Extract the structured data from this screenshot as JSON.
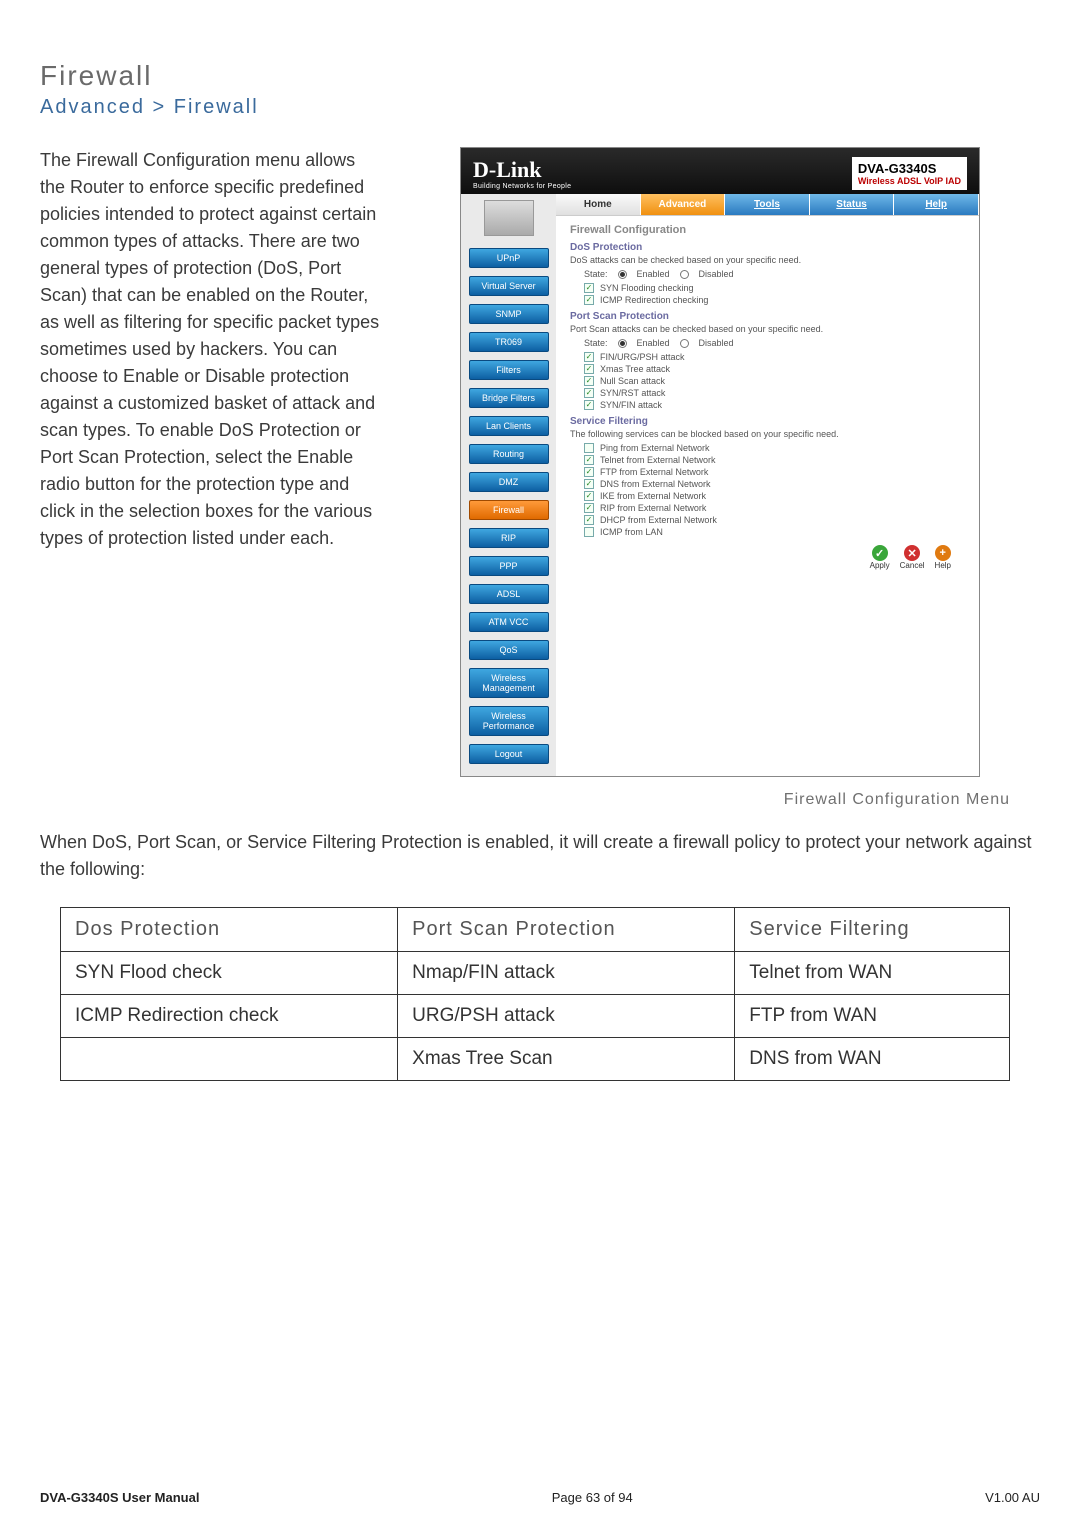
{
  "page": {
    "title": "Firewall",
    "breadcrumb": "Advanced > Firewall",
    "intro": "The Firewall Configuration menu allows the Router to enforce specific predefined policies intended to protect against certain common types of attacks. There are two general types of protection (DoS, Port Scan) that can be enabled on the Router, as well as filtering for specific packet types sometimes used by hackers. You can choose to Enable or Disable protection against a customized basket of attack and scan types. To enable DoS Protection or Port Scan Protection, select the Enable radio button for the protection type and click in the selection boxes for the various types of protection listed under each."
  },
  "screenshot": {
    "brand": "D-Link",
    "brand_sub": "Building Networks for People",
    "model": "DVA-G3340S",
    "model_sub": "Wireless ADSL VoIP IAD",
    "tabs": [
      "Home",
      "Advanced",
      "Tools",
      "Status",
      "Help"
    ],
    "tab_active": 1,
    "sidebar": [
      "UPnP",
      "Virtual Server",
      "SNMP",
      "TR069",
      "Filters",
      "Bridge Filters",
      "Lan Clients",
      "Routing",
      "DMZ",
      "Firewall",
      "RIP",
      "PPP",
      "ADSL",
      "ATM VCC",
      "QoS",
      "Wireless Management",
      "Wireless Performance",
      "Logout"
    ],
    "sidebar_active": 9,
    "fc_title": "Firewall Configuration",
    "dos": {
      "title": "DoS Protection",
      "desc": "DoS attacks can be checked based on your specific need.",
      "state_label": "State:",
      "enabled": "Enabled",
      "disabled": "Disabled",
      "checks": [
        "SYN Flooding checking",
        "ICMP Redirection checking"
      ]
    },
    "portscan": {
      "title": "Port Scan Protection",
      "desc": "Port Scan attacks can be checked based on your specific need.",
      "state_label": "State:",
      "enabled": "Enabled",
      "disabled": "Disabled",
      "checks": [
        "FIN/URG/PSH attack",
        "Xmas Tree attack",
        "Null Scan attack",
        "SYN/RST attack",
        "SYN/FIN attack"
      ]
    },
    "service": {
      "title": "Service Filtering",
      "desc": "The following services can be blocked based on your specific need.",
      "items": [
        {
          "label": "Ping from External Network",
          "checked": false
        },
        {
          "label": "Telnet from External Network",
          "checked": true
        },
        {
          "label": "FTP from External Network",
          "checked": true
        },
        {
          "label": "DNS from External Network",
          "checked": true
        },
        {
          "label": "IKE from External Network",
          "checked": true
        },
        {
          "label": "RIP from External Network",
          "checked": true
        },
        {
          "label": "DHCP from External Network",
          "checked": true
        },
        {
          "label": "ICMP from LAN",
          "checked": false
        }
      ]
    },
    "actions": [
      "Apply",
      "Cancel",
      "Help"
    ],
    "caption": "Firewall Configuration Menu"
  },
  "below": "When DoS, Port Scan, or Service Filtering Protection is enabled, it will create a firewall policy to protect your network against the following:",
  "table": {
    "headers": [
      "Dos Protection",
      "Port Scan Protection",
      "Service Filtering"
    ],
    "rows": [
      [
        "SYN Flood check",
        "Nmap/FIN attack",
        "Telnet from WAN"
      ],
      [
        "ICMP Redirection check",
        "URG/PSH attack",
        "FTP from WAN"
      ],
      [
        "",
        "Xmas Tree Scan",
        "DNS from WAN"
      ]
    ]
  },
  "footer": {
    "left": "DVA-G3340S User Manual",
    "center": "Page 63 of 94",
    "right": "V1.00 AU"
  }
}
